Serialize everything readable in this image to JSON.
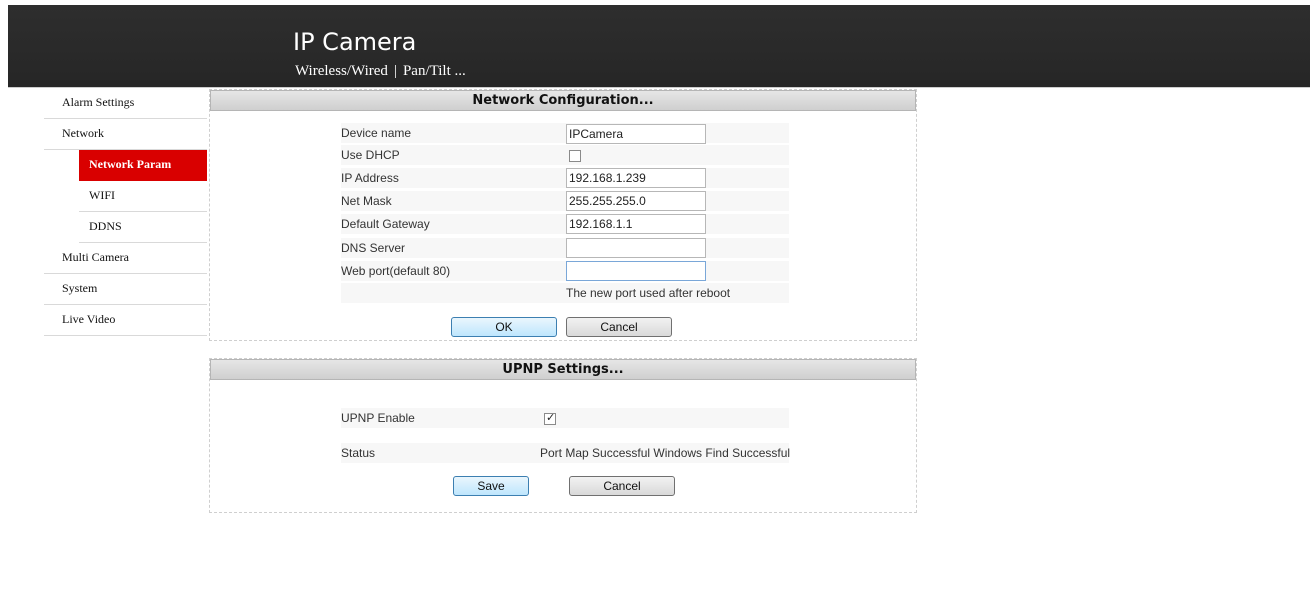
{
  "header": {
    "title": "IP Camera",
    "nav": [
      "Wireless/Wired",
      "Pan/Tilt ..."
    ],
    "nav_separator": "|"
  },
  "sidebar": {
    "items": [
      {
        "label": "Alarm Settings"
      },
      {
        "label": "Network"
      },
      {
        "label": "Network Param",
        "active": true
      },
      {
        "label": "WIFI"
      },
      {
        "label": "DDNS"
      },
      {
        "label": "Multi Camera"
      },
      {
        "label": "System"
      },
      {
        "label": "Live Video"
      }
    ],
    "active_color": "#d90000"
  },
  "network": {
    "title": "Network Configuration...",
    "fields": {
      "device_name": {
        "label": "Device name",
        "value": "IPCamera"
      },
      "use_dhcp": {
        "label": "Use DHCP",
        "checked": false
      },
      "ip_address": {
        "label": "IP Address",
        "value": "192.168.1.239"
      },
      "net_mask": {
        "label": "Net Mask",
        "value": "255.255.255.0"
      },
      "default_gateway": {
        "label": "Default Gateway",
        "value": "192.168.1.1"
      },
      "dns_server": {
        "label": "DNS Server",
        "value": ""
      },
      "web_port": {
        "label": "Web port(default 80)",
        "value": ""
      }
    },
    "port_note": "The new port used after reboot",
    "ok_label": "OK",
    "cancel_label": "Cancel"
  },
  "upnp": {
    "title": "UPNP Settings...",
    "enable_label": "UPNP Enable",
    "enabled": true,
    "status_label": "Status",
    "status_value": "Port Map Successful Windows Find Successful",
    "save_label": "Save",
    "cancel_label": "Cancel"
  }
}
